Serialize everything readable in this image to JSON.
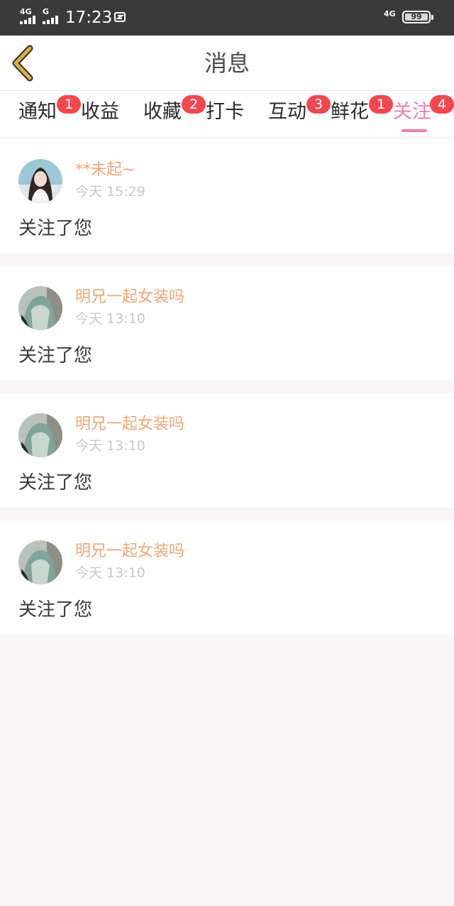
{
  "status_bar": {
    "network_left_1": "4G",
    "network_left_2": "G",
    "time": "17:23",
    "network_right": "4G",
    "battery": "99"
  },
  "header": {
    "title": "消息",
    "back_icon": "chevron-left-icon"
  },
  "tabs": [
    {
      "label": "通知",
      "badge": "1"
    },
    {
      "label": "收益",
      "badge": ""
    },
    {
      "label": "收藏",
      "badge": "2"
    },
    {
      "label": "打卡",
      "badge": ""
    },
    {
      "label": "互动",
      "badge": "3"
    },
    {
      "label": "鲜花",
      "badge": "1"
    },
    {
      "label": "关注",
      "badge": "4",
      "active": true
    }
  ],
  "messages": [
    {
      "name": "**未起~",
      "time": "今天 15:29",
      "text": "关注了您"
    },
    {
      "name": "明兄一起女装吗",
      "time": "今天 13:10",
      "text": "关注了您"
    },
    {
      "name": "明兄一起女装吗",
      "time": "今天 13:10",
      "text": "关注了您"
    },
    {
      "name": "明兄一起女装吗",
      "time": "今天 13:10",
      "text": "关注了您"
    }
  ],
  "colors": {
    "accent_pink": "#ee7fb3",
    "badge_red": "#f2474f",
    "name_orange": "#f0a675",
    "back_arrow_gold": "#c9a12a"
  }
}
